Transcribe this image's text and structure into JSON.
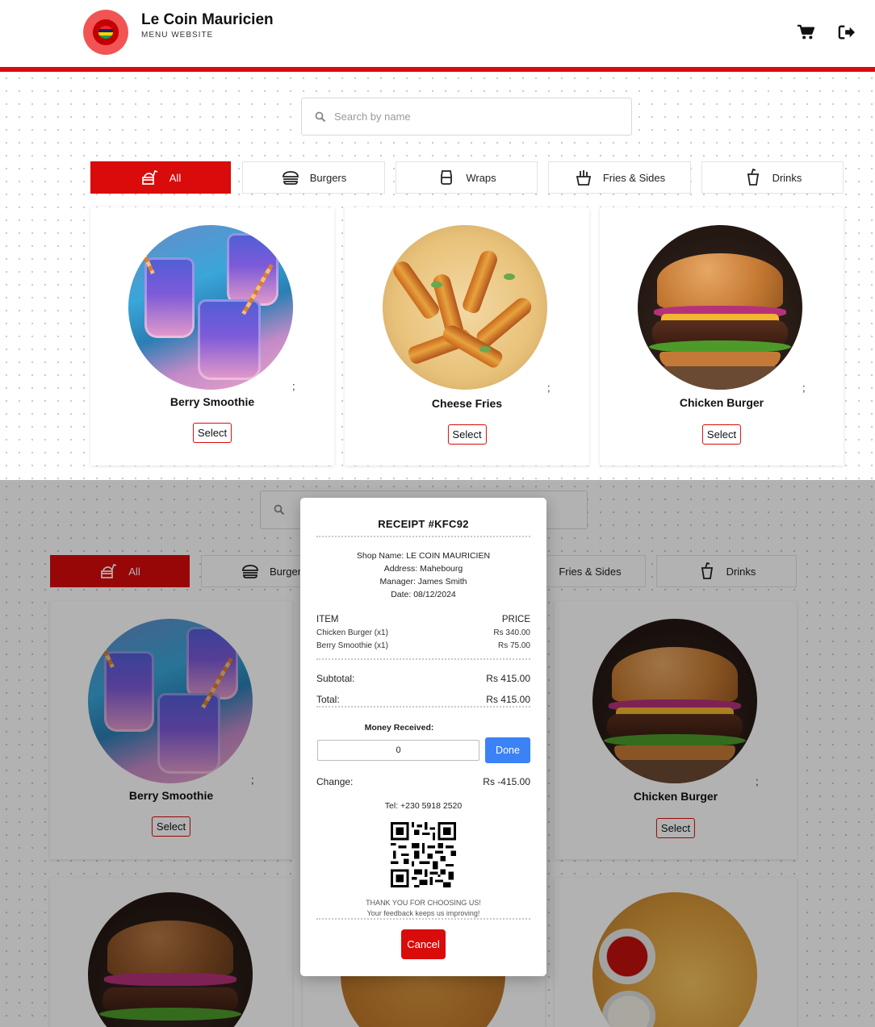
{
  "header": {
    "brand_title": "Le Coin Mauricien",
    "brand_subtitle": "MENU WEBSITE",
    "icons": [
      "cart-icon",
      "logout-icon"
    ]
  },
  "search": {
    "placeholder": "Search by name"
  },
  "categories": [
    {
      "label": "All",
      "icon": "fast-food-icon",
      "active": true
    },
    {
      "label": "Burgers",
      "icon": "burger-icon"
    },
    {
      "label": "Wraps",
      "icon": "wrap-icon"
    },
    {
      "label": "Fries & Sides",
      "icon": "fries-icon"
    },
    {
      "label": "Drinks",
      "icon": "drink-icon"
    }
  ],
  "products": [
    {
      "name": "Berry Smoothie",
      "button": "Select",
      "extra": ";"
    },
    {
      "name": "Cheese Fries",
      "button": "Select",
      "extra": ";"
    },
    {
      "name": "Chicken Burger",
      "button": "Select",
      "extra": ";"
    }
  ],
  "receipt": {
    "title": "RECEIPT #KFC92",
    "shop_line": "Shop Name: LE COIN MAURICIEN",
    "address_line": "Address: Mahebourg",
    "manager_line": "Manager: James Smith",
    "date_line": "Date: 08/12/2024",
    "col_item": "ITEM",
    "col_price": "PRICE",
    "items": [
      {
        "name": "Chicken Burger (x1)",
        "price": "Rs 340.00"
      },
      {
        "name": "Berry Smoothie (x1)",
        "price": "Rs 75.00"
      }
    ],
    "subtotal_label": "Subtotal:",
    "subtotal_value": "Rs 415.00",
    "total_label": "Total:",
    "total_value": "Rs 415.00",
    "money_label": "Money Received:",
    "money_value": "0",
    "done_label": "Done",
    "change_label": "Change:",
    "change_value": "Rs -415.00",
    "tel_line": "Tel: +230 5918 2520",
    "thanks_line1": "THANK YOU FOR CHOOSING US!",
    "thanks_line2": "Your feedback keeps us improving!",
    "cancel_label": "Cancel"
  },
  "colors": {
    "accent": "#d90b0b",
    "done_button": "#3b82f6"
  }
}
